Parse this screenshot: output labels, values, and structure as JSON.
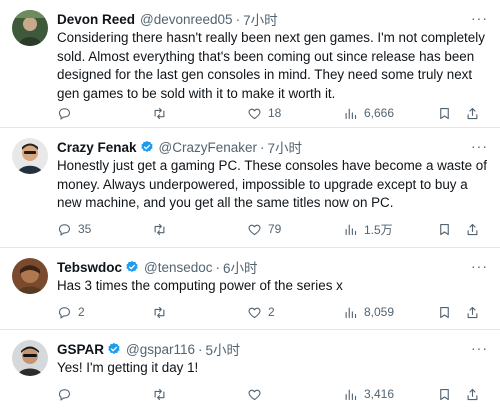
{
  "tweets": [
    {
      "name": "Devon Reed",
      "verified": false,
      "handle": "@devonreed05",
      "dot": "·",
      "time": "7小时",
      "text": "Considering there hasn't really been next gen games. I'm not completely sold. Almost everything that's been coming out since release has been designed for the last gen consoles in mind. They need some truly next gen games to be sold with it to make it worth it.",
      "replies": "",
      "retweets": "",
      "likes": "18",
      "views": "6,666"
    },
    {
      "name": "Crazy Fenak",
      "verified": true,
      "handle": "@CrazyFenaker",
      "dot": "·",
      "time": "7小时",
      "text": "Honestly just get a gaming PC. These consoles have become a waste of money. Always underpowered, impossible to upgrade except to buy a new machine, and you get all the same titles now on PC.",
      "replies": "35",
      "retweets": "",
      "likes": "79",
      "views": "1.5万"
    },
    {
      "name": "Tebswdoc",
      "verified": true,
      "handle": "@tensedoc",
      "dot": "·",
      "time": "6小时",
      "text": "Has 3 times the computing power of the series x",
      "replies": "2",
      "retweets": "",
      "likes": "2",
      "views": "8,059"
    },
    {
      "name": "GSPAR",
      "verified": true,
      "handle": "@gspar116",
      "dot": "·",
      "time": "5小时",
      "text": "Yes! I'm getting it day 1!",
      "replies": "",
      "retweets": "",
      "likes": "",
      "views": "3,416"
    }
  ],
  "icons": {
    "reply": "reply-icon",
    "retweet": "retweet-icon",
    "like": "like-icon",
    "views": "views-icon",
    "bookmark": "bookmark-icon",
    "share": "share-icon",
    "more": "more-icon",
    "verified": "verified-badge-icon"
  },
  "colors": {
    "text": "#0f1419",
    "secondary": "#536471",
    "verified": "#1d9bf0",
    "divider": "#e3e6e9"
  }
}
